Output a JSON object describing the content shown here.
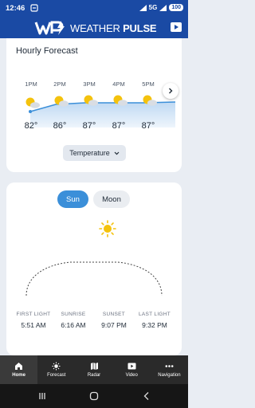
{
  "status_bar": {
    "time": "12:46",
    "network": "5G",
    "battery": "100"
  },
  "header": {
    "brand_part1": "WEATHER",
    "brand_part2": "PULSE",
    "logo_text": "WP"
  },
  "hourly": {
    "title": "Hourly Forecast",
    "hours": [
      {
        "time": "1PM",
        "temp": "82°"
      },
      {
        "time": "2PM",
        "temp": "86°"
      },
      {
        "time": "3PM",
        "temp": "87°"
      },
      {
        "time": "4PM",
        "temp": "87°"
      },
      {
        "time": "5PM",
        "temp": "87°"
      }
    ],
    "selector_label": "Temperature"
  },
  "sun_moon": {
    "tabs": {
      "sun": "Sun",
      "moon": "Moon"
    },
    "columns": [
      {
        "label": "FIRST LIGHT",
        "value": "5:51 AM"
      },
      {
        "label": "SUNRISE",
        "value": "6:16 AM"
      },
      {
        "label": "SUNSET",
        "value": "9:07 PM"
      },
      {
        "label": "LAST LIGHT",
        "value": "9:32 PM"
      }
    ]
  },
  "nav": [
    {
      "label": "Home",
      "icon": "home-icon"
    },
    {
      "label": "Forecast",
      "icon": "sun-icon"
    },
    {
      "label": "Radar",
      "icon": "map-icon"
    },
    {
      "label": "Video",
      "icon": "play-icon"
    },
    {
      "label": "Navigation",
      "icon": "dots-icon"
    }
  ],
  "colors": {
    "brand": "#1a4aa4",
    "accent": "#3b8fd9",
    "nav_bg": "#2a2a2a"
  }
}
